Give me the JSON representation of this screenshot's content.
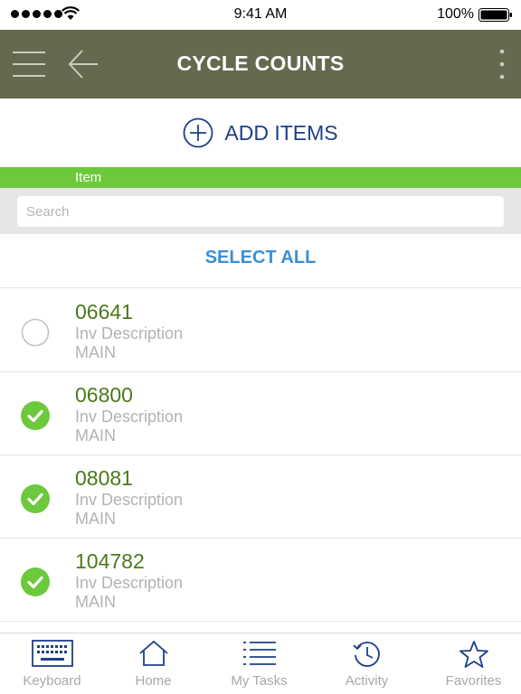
{
  "status_bar": {
    "time": "9:41 AM",
    "battery": "100%"
  },
  "header": {
    "title": "CYCLE COUNTS"
  },
  "add_items": {
    "label": "ADD ITEMS"
  },
  "column_header": "Item",
  "search": {
    "placeholder": "Search"
  },
  "select_all": "SELECT ALL",
  "items": [
    {
      "number": "06641",
      "description": "Inv Description",
      "location": "MAIN",
      "checked": false
    },
    {
      "number": "06800",
      "description": "Inv Description",
      "location": "MAIN",
      "checked": true
    },
    {
      "number": "08081",
      "description": "Inv Description",
      "location": "MAIN",
      "checked": true
    },
    {
      "number": "104782",
      "description": "Inv Description",
      "location": "MAIN",
      "checked": true
    }
  ],
  "tab_bar": {
    "tabs": [
      {
        "label": "Keyboard",
        "icon": "keyboard-icon"
      },
      {
        "label": "Home",
        "icon": "home-icon"
      },
      {
        "label": "My Tasks",
        "icon": "list-icon"
      },
      {
        "label": "Activity",
        "icon": "history-icon"
      },
      {
        "label": "Favorites",
        "icon": "star-icon"
      }
    ]
  },
  "colors": {
    "header_bg": "#646a4f",
    "accent_green": "#6cc93c",
    "navy": "#1d3f8a",
    "link_blue": "#3b8fd6",
    "item_number": "#4a7a1a"
  }
}
